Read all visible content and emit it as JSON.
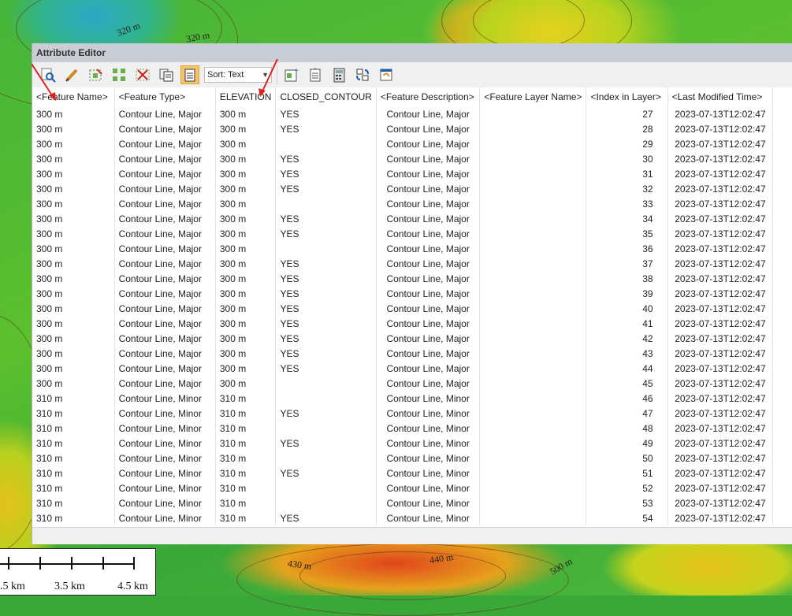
{
  "window": {
    "title": "Attribute Editor"
  },
  "toolbar": {
    "sort_label": "Sort: Text",
    "icons": [
      "zoom-to-feature-icon",
      "edit-icon",
      "select-icon",
      "select-all-icon",
      "delete-icon",
      "copy-icon",
      "paste-icon",
      "sort-icon",
      "add-column-icon",
      "column-properties-icon",
      "calculator-icon",
      "swap-icon",
      "refresh-icon"
    ]
  },
  "columns": [
    "<Feature Name>",
    "<Feature Type>",
    "ELEVATION",
    "CLOSED_CONTOUR",
    "<Feature Description>",
    "<Feature Layer Name>",
    "<Index in Layer>",
    "<Last Modified Time>"
  ],
  "rows": [
    [
      "300 m",
      "Contour Line, Major",
      "300 m",
      "YES",
      "Contour Line, Major",
      "",
      "27",
      "2023-07-13T12:02:47"
    ],
    [
      "300 m",
      "Contour Line, Major",
      "300 m",
      "YES",
      "Contour Line, Major",
      "",
      "28",
      "2023-07-13T12:02:47"
    ],
    [
      "300 m",
      "Contour Line, Major",
      "300 m",
      "",
      "Contour Line, Major",
      "",
      "29",
      "2023-07-13T12:02:47"
    ],
    [
      "300 m",
      "Contour Line, Major",
      "300 m",
      "YES",
      "Contour Line, Major",
      "",
      "30",
      "2023-07-13T12:02:47"
    ],
    [
      "300 m",
      "Contour Line, Major",
      "300 m",
      "YES",
      "Contour Line, Major",
      "",
      "31",
      "2023-07-13T12:02:47"
    ],
    [
      "300 m",
      "Contour Line, Major",
      "300 m",
      "YES",
      "Contour Line, Major",
      "",
      "32",
      "2023-07-13T12:02:47"
    ],
    [
      "300 m",
      "Contour Line, Major",
      "300 m",
      "",
      "Contour Line, Major",
      "",
      "33",
      "2023-07-13T12:02:47"
    ],
    [
      "300 m",
      "Contour Line, Major",
      "300 m",
      "YES",
      "Contour Line, Major",
      "",
      "34",
      "2023-07-13T12:02:47"
    ],
    [
      "300 m",
      "Contour Line, Major",
      "300 m",
      "YES",
      "Contour Line, Major",
      "",
      "35",
      "2023-07-13T12:02:47"
    ],
    [
      "300 m",
      "Contour Line, Major",
      "300 m",
      "",
      "Contour Line, Major",
      "",
      "36",
      "2023-07-13T12:02:47"
    ],
    [
      "300 m",
      "Contour Line, Major",
      "300 m",
      "YES",
      "Contour Line, Major",
      "",
      "37",
      "2023-07-13T12:02:47"
    ],
    [
      "300 m",
      "Contour Line, Major",
      "300 m",
      "YES",
      "Contour Line, Major",
      "",
      "38",
      "2023-07-13T12:02:47"
    ],
    [
      "300 m",
      "Contour Line, Major",
      "300 m",
      "YES",
      "Contour Line, Major",
      "",
      "39",
      "2023-07-13T12:02:47"
    ],
    [
      "300 m",
      "Contour Line, Major",
      "300 m",
      "YES",
      "Contour Line, Major",
      "",
      "40",
      "2023-07-13T12:02:47"
    ],
    [
      "300 m",
      "Contour Line, Major",
      "300 m",
      "YES",
      "Contour Line, Major",
      "",
      "41",
      "2023-07-13T12:02:47"
    ],
    [
      "300 m",
      "Contour Line, Major",
      "300 m",
      "YES",
      "Contour Line, Major",
      "",
      "42",
      "2023-07-13T12:02:47"
    ],
    [
      "300 m",
      "Contour Line, Major",
      "300 m",
      "YES",
      "Contour Line, Major",
      "",
      "43",
      "2023-07-13T12:02:47"
    ],
    [
      "300 m",
      "Contour Line, Major",
      "300 m",
      "YES",
      "Contour Line, Major",
      "",
      "44",
      "2023-07-13T12:02:47"
    ],
    [
      "300 m",
      "Contour Line, Major",
      "300 m",
      "",
      "Contour Line, Major",
      "",
      "45",
      "2023-07-13T12:02:47"
    ],
    [
      "310 m",
      "Contour Line, Minor",
      "310 m",
      "",
      "Contour Line, Minor",
      "",
      "46",
      "2023-07-13T12:02:47"
    ],
    [
      "310 m",
      "Contour Line, Minor",
      "310 m",
      "YES",
      "Contour Line, Minor",
      "",
      "47",
      "2023-07-13T12:02:47"
    ],
    [
      "310 m",
      "Contour Line, Minor",
      "310 m",
      "",
      "Contour Line, Minor",
      "",
      "48",
      "2023-07-13T12:02:47"
    ],
    [
      "310 m",
      "Contour Line, Minor",
      "310 m",
      "YES",
      "Contour Line, Minor",
      "",
      "49",
      "2023-07-13T12:02:47"
    ],
    [
      "310 m",
      "Contour Line, Minor",
      "310 m",
      "",
      "Contour Line, Minor",
      "",
      "50",
      "2023-07-13T12:02:47"
    ],
    [
      "310 m",
      "Contour Line, Minor",
      "310 m",
      "YES",
      "Contour Line, Minor",
      "",
      "51",
      "2023-07-13T12:02:47"
    ],
    [
      "310 m",
      "Contour Line, Minor",
      "310 m",
      "",
      "Contour Line, Minor",
      "",
      "52",
      "2023-07-13T12:02:47"
    ],
    [
      "310 m",
      "Contour Line, Minor",
      "310 m",
      "",
      "Contour Line, Minor",
      "",
      "53",
      "2023-07-13T12:02:47"
    ],
    [
      "310 m",
      "Contour Line, Minor",
      "310 m",
      "YES",
      "Contour Line, Minor",
      "",
      "54",
      "2023-07-13T12:02:47"
    ]
  ],
  "map": {
    "labels": [
      "320 m",
      "320 m",
      "430 m",
      "440 m",
      "500 m"
    ],
    "scale_labels": [
      ".5 km",
      "3.5 km",
      "4.5 km"
    ]
  },
  "colors": {
    "active_tool": "#f5c46a",
    "titlebar": "#c8cdd6",
    "annotation_arrow": "#e0201c"
  }
}
